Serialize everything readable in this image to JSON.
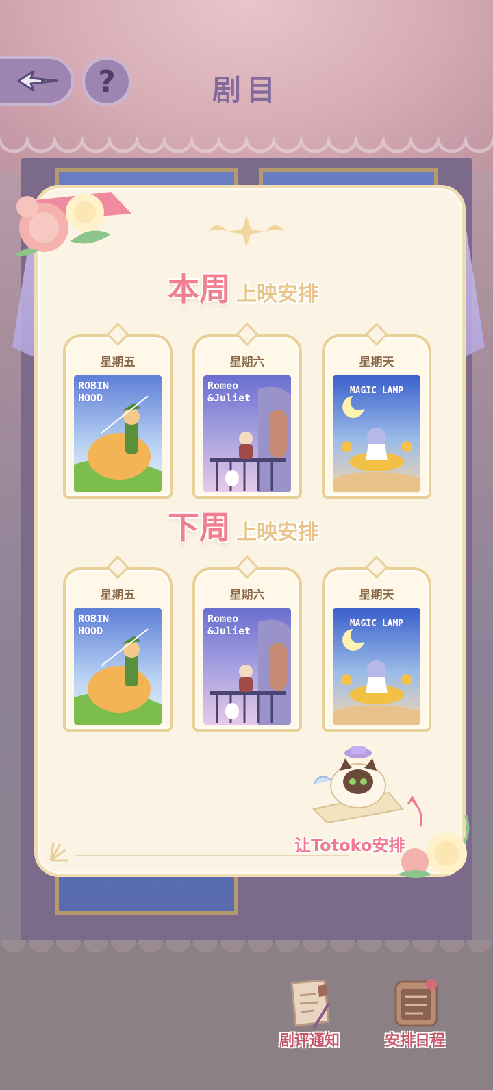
{
  "header": {
    "title": "剧目",
    "help_label": "?"
  },
  "this_week": {
    "title_big": "本周",
    "title_small": "上映安排",
    "days": [
      {
        "day": "星期五",
        "poster": "ROBIN\nHOOD"
      },
      {
        "day": "星期六",
        "poster": "Romeo\n&Juliet"
      },
      {
        "day": "星期天",
        "poster": "MAGIC LAMP"
      }
    ]
  },
  "next_week": {
    "title_big": "下周",
    "title_small": "上映安排",
    "days": [
      {
        "day": "星期五",
        "poster": "ROBIN\nHOOD"
      },
      {
        "day": "星期六",
        "poster": "Romeo\n&Juliet"
      },
      {
        "day": "星期天",
        "poster": "MAGIC LAMP"
      }
    ]
  },
  "assistant": {
    "label": "让Totoko安排",
    "note_text": "让Totoko"
  },
  "bottom": {
    "reviews_label": "剧评通知",
    "schedule_label": "安排日程"
  },
  "colors": {
    "accent_pink": "#f0808f",
    "card_border": "#e9cf98",
    "modal_bg": "#fbf3e3"
  }
}
